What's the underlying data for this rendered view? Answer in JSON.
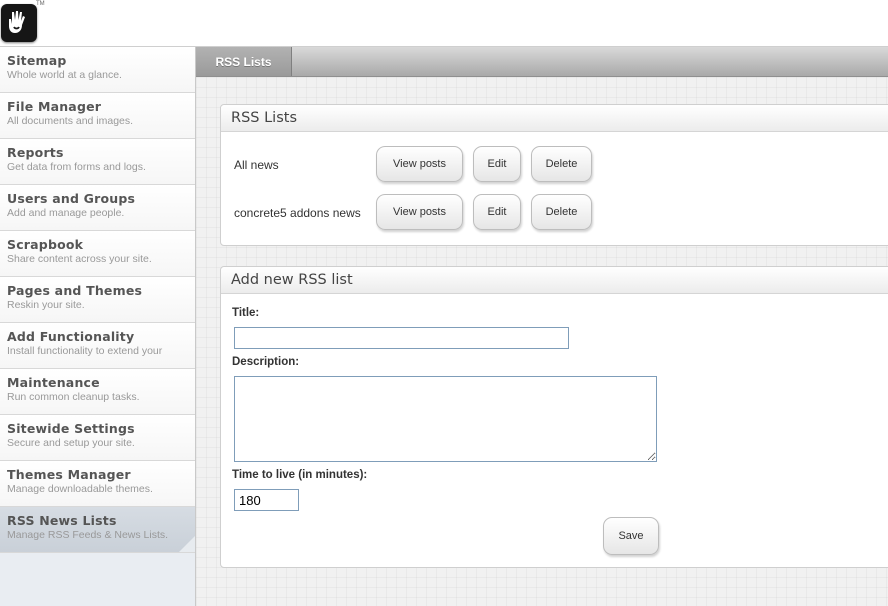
{
  "header": {
    "logo_mark": "TM"
  },
  "sidebar": {
    "items": [
      {
        "label": "Sitemap",
        "desc": "Whole world at a glance."
      },
      {
        "label": "File Manager",
        "desc": "All documents and images."
      },
      {
        "label": "Reports",
        "desc": "Get data from forms and logs."
      },
      {
        "label": "Users and Groups",
        "desc": "Add and manage people."
      },
      {
        "label": "Scrapbook",
        "desc": "Share content across your site."
      },
      {
        "label": "Pages and Themes",
        "desc": "Reskin your site."
      },
      {
        "label": "Add Functionality",
        "desc": "Install functionality to extend your"
      },
      {
        "label": "Maintenance",
        "desc": "Run common cleanup tasks."
      },
      {
        "label": "Sitewide Settings",
        "desc": "Secure and setup your site."
      },
      {
        "label": "Themes Manager",
        "desc": "Manage downloadable themes."
      },
      {
        "label": "RSS News Lists",
        "desc": "Manage RSS Feeds & News Lists."
      }
    ]
  },
  "main": {
    "tab_label": "RSS Lists",
    "list_panel": {
      "title": "RSS Lists",
      "rows": [
        {
          "name": "All news",
          "view": "View posts",
          "edit": "Edit",
          "delete": "Delete"
        },
        {
          "name": "concrete5 addons news",
          "view": "View posts",
          "edit": "Edit",
          "delete": "Delete"
        }
      ]
    },
    "add_panel": {
      "title": "Add new RSS list",
      "title_label": "Title:",
      "title_value": "",
      "description_label": "Description:",
      "description_value": "",
      "ttl_label": "Time to live (in minutes):",
      "ttl_value": "180",
      "save_label": "Save"
    }
  },
  "colors": {
    "sidebar_active": "#cfd5dc",
    "tab_gray": "#a9a9a9",
    "input_border": "#7f9db9"
  }
}
